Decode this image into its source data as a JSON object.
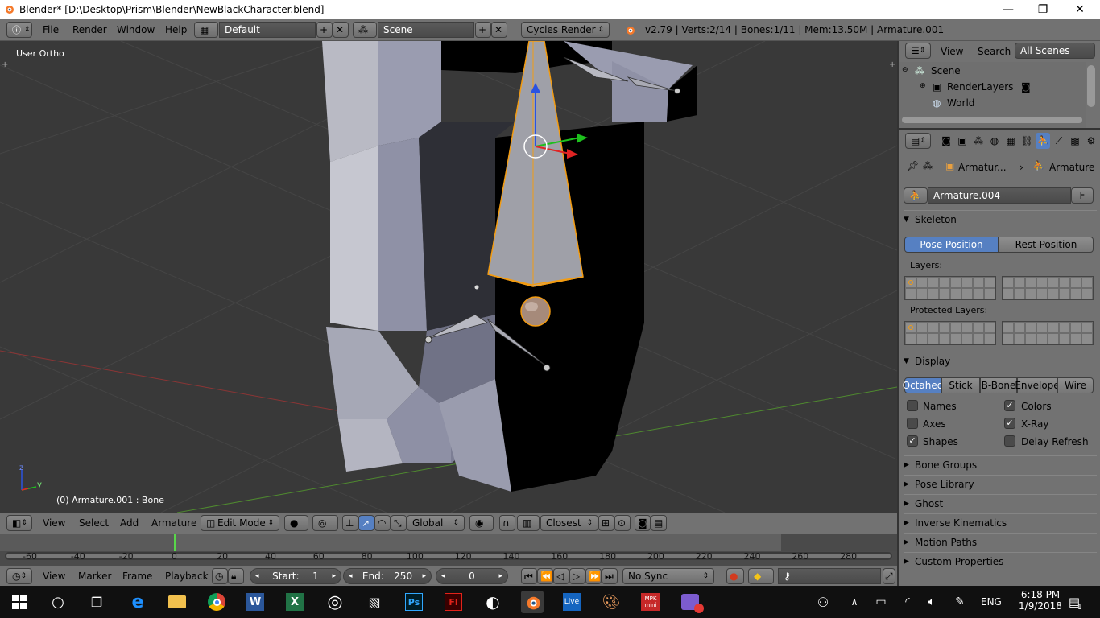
{
  "window": {
    "title": "Blender* [D:\\Desktop\\Prism\\Blender\\NewBlackCharacter.blend]",
    "minimize": "—",
    "maximize": "❐",
    "close": "✕"
  },
  "info_header": {
    "menus": [
      "File",
      "Render",
      "Window",
      "Help"
    ],
    "layout": "Default",
    "scene": "Scene",
    "engine": "Cycles Render",
    "stats": "v2.79 | Verts:2/14 | Bones:1/11 | Mem:13.50M | Armature.001"
  },
  "viewport": {
    "view_label": "User Ortho",
    "object_label": "(0) Armature.001 : Bone",
    "axis_x": "x",
    "axis_y": "y",
    "axis_z": "z"
  },
  "viewport_header": {
    "menus": [
      "View",
      "Select",
      "Add",
      "Armature"
    ],
    "mode": "Edit Mode",
    "orientation": "Global",
    "snap_target": "Closest"
  },
  "timeline": {
    "ticks": [
      "-60",
      "-40",
      "-20",
      "0",
      "20",
      "40",
      "60",
      "80",
      "100",
      "120",
      "140",
      "160",
      "180",
      "200",
      "220",
      "240",
      "260",
      "280"
    ],
    "menus": [
      "View",
      "Marker",
      "Frame",
      "Playback"
    ],
    "start_label": "Start:",
    "start_value": "1",
    "end_label": "End:",
    "end_value": "250",
    "current_frame": "0",
    "sync": "No Sync"
  },
  "outliner": {
    "menus": [
      "View",
      "Search"
    ],
    "filter": "All Scenes",
    "items": [
      "Scene",
      "RenderLayers",
      "World"
    ]
  },
  "properties": {
    "breadcrumb_object": "Armatur...",
    "breadcrumb_data": "Armature",
    "datablock_name": "Armature.004",
    "fake_user": "F",
    "skeleton": {
      "title": "Skeleton",
      "pose_position": "Pose Position",
      "rest_position": "Rest Position",
      "layers_label": "Layers:",
      "protected_label": "Protected Layers:"
    },
    "display": {
      "title": "Display",
      "modes": [
        "Octahed",
        "Stick",
        "B-Bone",
        "Envelope",
        "Wire"
      ],
      "active_mode": "Octahed",
      "options": {
        "names": "Names",
        "colors": "Colors",
        "axes": "Axes",
        "xray": "X-Ray",
        "shapes": "Shapes",
        "delay_refresh": "Delay Refresh"
      }
    },
    "collapsed_panels": [
      "Bone Groups",
      "Pose Library",
      "Ghost",
      "Inverse Kinematics",
      "Motion Paths",
      "Custom Properties"
    ]
  },
  "taskbar": {
    "time": "6:18 PM",
    "date": "1/9/2018",
    "language": "ENG",
    "apps": [
      "Live",
      "MPK mini"
    ],
    "notification_count": "1"
  },
  "colors": {
    "selection_orange": "#f39c12",
    "active_blue": "#5680c2",
    "viewport_bg": "#393939",
    "panel_bg": "#727272"
  }
}
